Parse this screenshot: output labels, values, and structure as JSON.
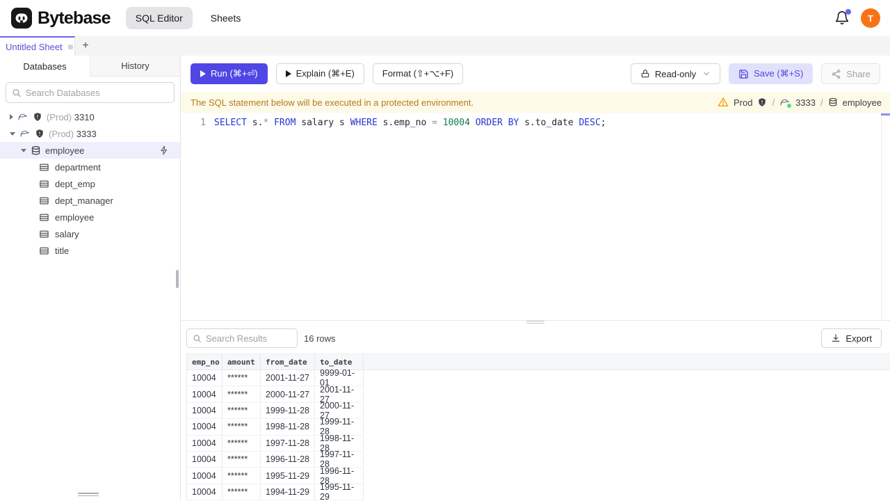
{
  "header": {
    "brand": "Bytebase",
    "nav": [
      {
        "label": "SQL Editor",
        "active": true
      },
      {
        "label": "Sheets",
        "active": false
      }
    ],
    "avatar_initial": "T"
  },
  "tabstrip": {
    "active_tab": "Untitled Sheet",
    "add_label": "+"
  },
  "sidebar": {
    "tabs": [
      {
        "label": "Databases",
        "active": true
      },
      {
        "label": "History",
        "active": false
      }
    ],
    "search_placeholder": "Search Databases",
    "instances": [
      {
        "env": "(Prod)",
        "name": "3310",
        "expanded": false
      },
      {
        "env": "(Prod)",
        "name": "3333",
        "expanded": true
      }
    ],
    "database": {
      "name": "employee",
      "selected": true
    },
    "tables": [
      "department",
      "dept_emp",
      "dept_manager",
      "employee",
      "salary",
      "title"
    ]
  },
  "toolbar": {
    "run_label": "Run (⌘+⏎)",
    "explain_label": "Explain (⌘+E)",
    "format_label": "Format (⇧+⌥+F)",
    "readonly_label": "Read-only",
    "save_label": "Save (⌘+S)",
    "share_label": "Share"
  },
  "banner": {
    "message": "The SQL statement below will be executed in a protected environment.",
    "environment": "Prod",
    "instance": "3333",
    "database": "employee",
    "separator": "/"
  },
  "editor": {
    "line_number": "1",
    "tokens": [
      {
        "text": "SELECT",
        "type": "keyword"
      },
      {
        "text": " s.",
        "type": "plain"
      },
      {
        "text": "*",
        "type": "operator"
      },
      {
        "text": " ",
        "type": "plain"
      },
      {
        "text": "FROM",
        "type": "keyword"
      },
      {
        "text": " salary s ",
        "type": "plain"
      },
      {
        "text": "WHERE",
        "type": "keyword"
      },
      {
        "text": " s.emp_no ",
        "type": "plain"
      },
      {
        "text": "=",
        "type": "operator"
      },
      {
        "text": " ",
        "type": "plain"
      },
      {
        "text": "10004",
        "type": "number"
      },
      {
        "text": " ",
        "type": "plain"
      },
      {
        "text": "ORDER BY",
        "type": "keyword"
      },
      {
        "text": " s.to_date ",
        "type": "plain"
      },
      {
        "text": "DESC",
        "type": "keyword"
      },
      {
        "text": ";",
        "type": "plain"
      }
    ]
  },
  "results": {
    "search_placeholder": "Search Results",
    "row_count": "16 rows",
    "export_label": "Export",
    "columns": [
      "emp_no",
      "amount",
      "from_date",
      "to_date"
    ],
    "rows": [
      [
        "10004",
        "******",
        "2001-11-27",
        "9999-01-01"
      ],
      [
        "10004",
        "******",
        "2000-11-27",
        "2001-11-27"
      ],
      [
        "10004",
        "******",
        "1999-11-28",
        "2000-11-27"
      ],
      [
        "10004",
        "******",
        "1998-11-28",
        "1999-11-28"
      ],
      [
        "10004",
        "******",
        "1997-11-28",
        "1998-11-28"
      ],
      [
        "10004",
        "******",
        "1996-11-28",
        "1997-11-28"
      ],
      [
        "10004",
        "******",
        "1995-11-29",
        "1996-11-28"
      ],
      [
        "10004",
        "******",
        "1994-11-29",
        "1995-11-29"
      ]
    ]
  },
  "colors": {
    "accent": "#4f46e5",
    "avatar": "#f97316",
    "banner_bg": "#fdfae8",
    "banner_text": "#b7791f",
    "keyword": "#2336d0",
    "number": "#0f7b4f",
    "selected_row_bg": "#edeffc",
    "status_ok": "#4ade80",
    "warning": "#f59e0b"
  }
}
